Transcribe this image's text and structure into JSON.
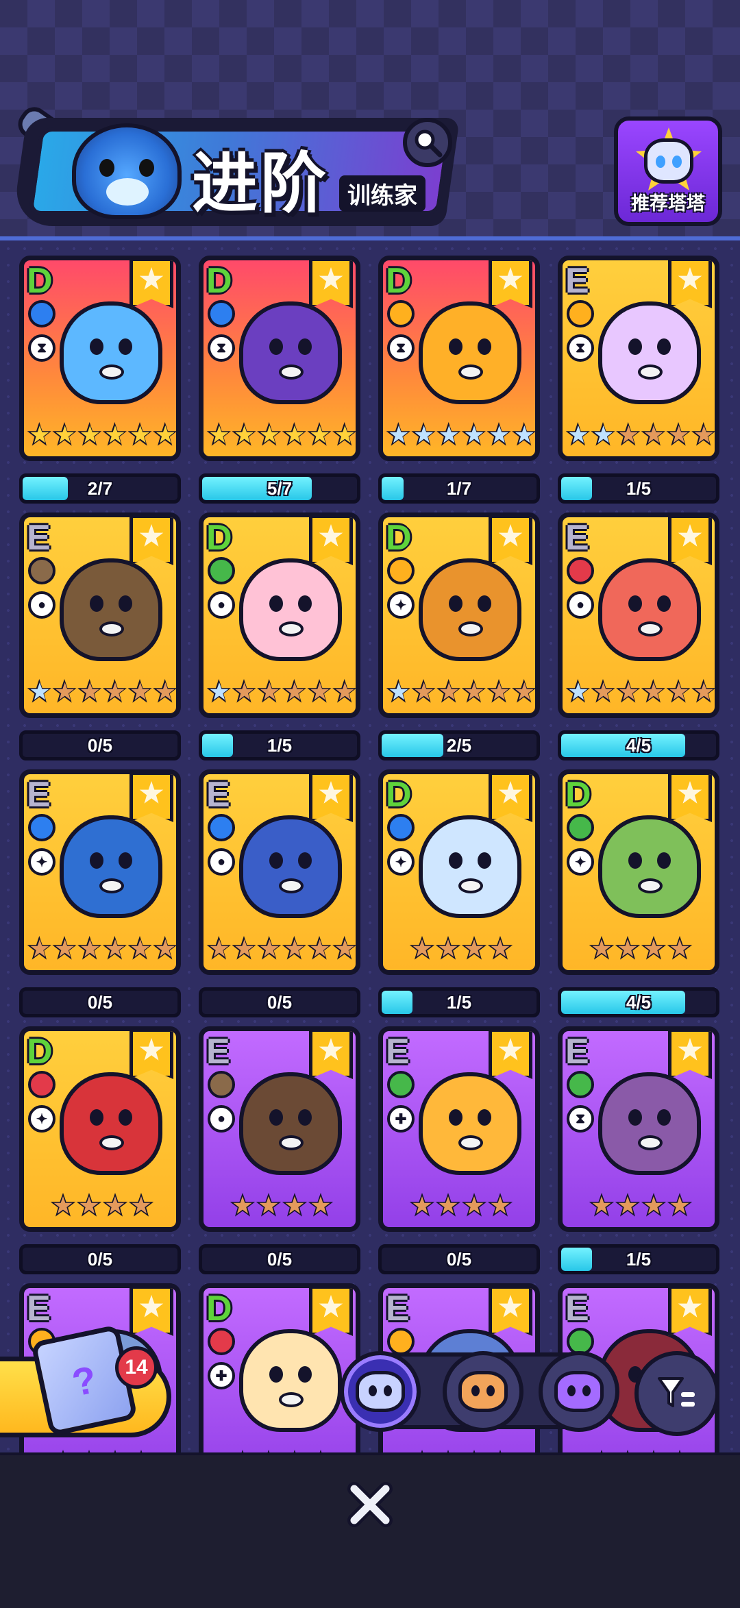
{
  "header": {
    "title": "进阶",
    "subtitle": "训练家",
    "recommend_label": "推荐塔塔"
  },
  "cards": [
    {
      "rank": "D",
      "element": "water",
      "role": "hourglass",
      "stars_filled": 6,
      "star_type": "gold",
      "bg": "red",
      "creature_color": "#5db8ff",
      "progress": "2/7",
      "fill": 0.29
    },
    {
      "rank": "D",
      "element": "water",
      "role": "hourglass",
      "stars_filled": 6,
      "star_type": "gold",
      "bg": "red",
      "creature_color": "#6b3fc0",
      "progress": "5/7",
      "fill": 0.71
    },
    {
      "rank": "D",
      "element": "lightning",
      "role": "hourglass",
      "stars_filled": 6,
      "star_type": "blue",
      "bg": "red",
      "creature_color": "#ffb028",
      "progress": "1/7",
      "fill": 0.14
    },
    {
      "rank": "E",
      "element": "lightning",
      "role": "hourglass",
      "stars_filled": 2,
      "star_type": "blue",
      "bg": "yellow",
      "creature_color": "#e8c7ff",
      "progress": "1/5",
      "fill": 0.2
    },
    {
      "rank": "E",
      "element": "earth",
      "role": "bust",
      "stars_filled": 1,
      "star_type": "blue",
      "bg": "yellow",
      "creature_color": "#7a5a3a",
      "progress": "0/5",
      "fill": 0
    },
    {
      "rank": "D",
      "element": "leaf",
      "role": "bust",
      "stars_filled": 1,
      "star_type": "blue",
      "bg": "yellow",
      "creature_color": "#ffc2d6",
      "progress": "1/5",
      "fill": 0.2
    },
    {
      "rank": "D",
      "element": "lightning",
      "role": "runner",
      "stars_filled": 1,
      "star_type": "blue",
      "bg": "yellow",
      "creature_color": "#e9932d",
      "progress": "2/5",
      "fill": 0.4
    },
    {
      "rank": "E",
      "element": "fire",
      "role": "bust",
      "stars_filled": 1,
      "star_type": "blue",
      "bg": "yellow",
      "creature_color": "#f0685a",
      "progress": "4/5",
      "fill": 0.8
    },
    {
      "rank": "E",
      "element": "water",
      "role": "runner",
      "stars_filled": 0,
      "star_type": "bronze",
      "bg": "yellow",
      "creature_color": "#2f6fd2",
      "progress": "0/5",
      "fill": 0
    },
    {
      "rank": "E",
      "element": "water",
      "role": "bust",
      "stars_filled": 0,
      "star_type": "bronze",
      "bg": "yellow",
      "creature_color": "#3a5ec8",
      "progress": "0/5",
      "fill": 0
    },
    {
      "rank": "D",
      "element": "water",
      "role": "runner",
      "stars_filled": 0,
      "star_type": "bronze",
      "bg": "yellow",
      "creature_color": "#cfe6ff",
      "progress": "1/5",
      "fill": 0.2
    },
    {
      "rank": "D",
      "element": "leaf",
      "role": "runner",
      "stars_filled": 0,
      "star_type": "bronze",
      "bg": "yellow",
      "creature_color": "#7fc05a",
      "progress": "4/5",
      "fill": 0.8
    },
    {
      "rank": "D",
      "element": "fire",
      "role": "runner",
      "stars_filled": 0,
      "star_type": "bronze",
      "bg": "yellow",
      "creature_color": "#d8343a",
      "progress": "0/5",
      "fill": 0
    },
    {
      "rank": "E",
      "element": "earth",
      "role": "bust",
      "stars_filled": 0,
      "star_type": "bronze",
      "bg": "purple",
      "creature_color": "#6b4a35",
      "progress": "0/5",
      "fill": 0
    },
    {
      "rank": "E",
      "element": "leaf",
      "role": "plus",
      "stars_filled": 0,
      "star_type": "bronze",
      "bg": "purple",
      "creature_color": "#ffb83a",
      "progress": "0/5",
      "fill": 0
    },
    {
      "rank": "E",
      "element": "leaf",
      "role": "hourglass",
      "stars_filled": 0,
      "star_type": "bronze",
      "bg": "purple",
      "creature_color": "#8a5aa8",
      "progress": "1/5",
      "fill": 0.2
    },
    {
      "rank": "E",
      "element": "lightning",
      "role": "",
      "stars_filled": 0,
      "star_type": "bronze",
      "bg": "purple",
      "creature_color": "#7a9bd8",
      "progress": "",
      "fill": 0
    },
    {
      "rank": "D",
      "element": "fire",
      "role": "plus",
      "stars_filled": 0,
      "star_type": "bronze",
      "bg": "purple",
      "creature_color": "#ffe4b0",
      "progress": "",
      "fill": 0
    },
    {
      "rank": "E",
      "element": "lightning",
      "role": "",
      "stars_filled": 0,
      "star_type": "bronze",
      "bg": "purple",
      "creature_color": "#5d7fd4",
      "progress": "",
      "fill": 0
    },
    {
      "rank": "E",
      "element": "leaf",
      "role": "",
      "stars_filled": 0,
      "star_type": "bronze",
      "bg": "purple",
      "creature_color": "#8a2a3a",
      "progress": "",
      "fill": 0
    }
  ],
  "gacha": {
    "badge_count": "14",
    "box_glyph": "?"
  },
  "tabs": [
    {
      "icon": "cat-face-icon",
      "color": "#c8d2ff",
      "active": true
    },
    {
      "icon": "bear-face-icon",
      "color": "#f2a45a",
      "active": false
    },
    {
      "icon": "star-cat-icon",
      "color": "#a46bff",
      "active": false
    }
  ],
  "colors": {
    "element": {
      "water": "#2d7ff0",
      "lightning": "#ffb01e",
      "earth": "#8a6a4a",
      "leaf": "#46b84a",
      "fire": "#e33a4a"
    }
  }
}
